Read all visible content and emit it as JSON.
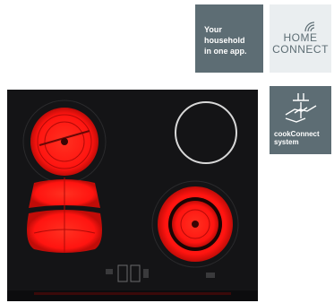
{
  "app_tile": {
    "lines": [
      "Your",
      "household",
      "in one app."
    ]
  },
  "home_connect_tile": {
    "line1": "HOME",
    "line2": "CONNECT",
    "icon": "wifi-icon"
  },
  "cookconnect_tile": {
    "line1": "cookConnect",
    "line2": "system",
    "icon": "hands-hood-icon"
  },
  "colors": {
    "tile_dark": "#5d6d74",
    "tile_light": "#eaeef0",
    "cooktop_black": "#141416",
    "burner_red": "#ff1410"
  }
}
